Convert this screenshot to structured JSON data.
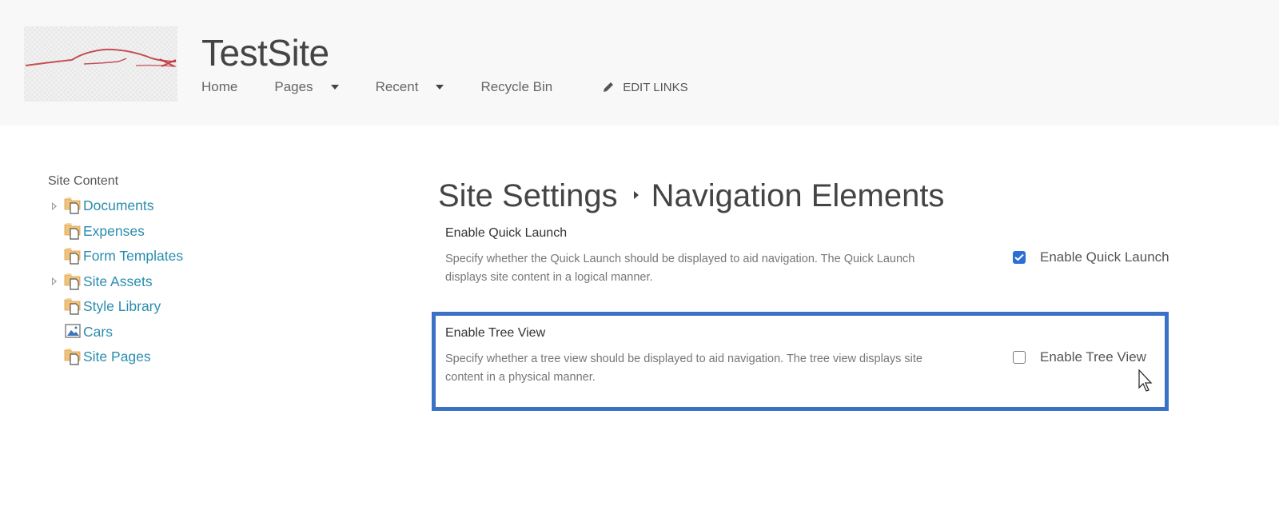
{
  "header": {
    "logo": "car-logo",
    "site_title": "TestSite",
    "nav": [
      {
        "label": "Home",
        "has_dropdown": false
      },
      {
        "label": "Pages",
        "has_dropdown": true
      },
      {
        "label": "Recent",
        "has_dropdown": true
      },
      {
        "label": "Recycle Bin",
        "has_dropdown": false
      }
    ],
    "edit_links": {
      "icon": "pencil-icon",
      "label": "EDIT LINKS"
    }
  },
  "quick_launch": {
    "title": "Site Content",
    "items": [
      {
        "label": "Documents",
        "icon": "document-library-icon",
        "expandable": true
      },
      {
        "label": "Expenses",
        "icon": "document-library-icon",
        "expandable": false
      },
      {
        "label": "Form Templates",
        "icon": "document-library-icon",
        "expandable": false
      },
      {
        "label": "Site Assets",
        "icon": "document-library-icon",
        "expandable": true
      },
      {
        "label": "Style Library",
        "icon": "document-library-icon",
        "expandable": false
      },
      {
        "label": "Cars",
        "icon": "picture-library-icon",
        "expandable": false
      },
      {
        "label": "Site Pages",
        "icon": "document-library-icon",
        "expandable": false
      }
    ]
  },
  "main": {
    "breadcrumb": {
      "parent": "Site Settings",
      "current": "Navigation Elements"
    },
    "sections": [
      {
        "title": "Enable Quick Launch",
        "description": "Specify whether the Quick Launch should be displayed to aid navigation.  The Quick Launch displays site content in a logical manner.",
        "option_label": "Enable Quick Launch",
        "checked": true
      },
      {
        "title": "Enable Tree View",
        "description": "Specify whether a tree view should be displayed to aid navigation.  The tree view displays site content in a physical manner.",
        "option_label": "Enable Tree View",
        "checked": false
      }
    ]
  },
  "colors": {
    "link": "#2a8dae",
    "checkbox_checked": "#2b6fd6",
    "highlight": "#3a72c6",
    "header_bg": "#f8f8f8"
  }
}
